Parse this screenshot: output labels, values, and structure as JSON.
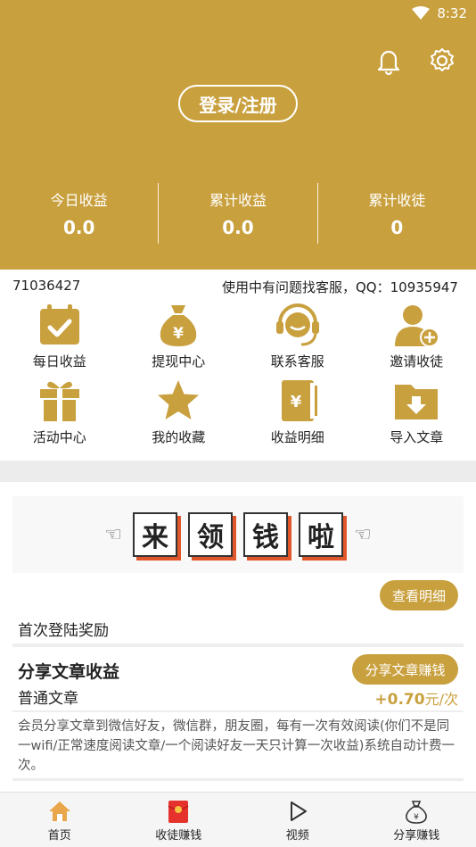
{
  "status_bar": {
    "time": "8:32"
  },
  "header": {
    "login_label": "登录/注册",
    "stats": [
      {
        "label": "今日收益",
        "value": "0.0"
      },
      {
        "label": "累计收益",
        "value": "0.0"
      },
      {
        "label": "累计收徒",
        "value": "0"
      }
    ]
  },
  "notice": {
    "left": "71036427",
    "right": "使用中有问题找客服，QQ：10935947"
  },
  "grid": [
    {
      "label": "每日收益",
      "icon": "calendar-check-icon"
    },
    {
      "label": "提现中心",
      "icon": "money-bag-icon"
    },
    {
      "label": "联系客服",
      "icon": "headset-icon"
    },
    {
      "label": "邀请收徒",
      "icon": "add-user-icon"
    },
    {
      "label": "活动中心",
      "icon": "gift-icon"
    },
    {
      "label": "我的收藏",
      "icon": "star-icon"
    },
    {
      "label": "收益明细",
      "icon": "ledger-icon"
    },
    {
      "label": "导入文章",
      "icon": "folder-download-icon"
    }
  ],
  "banner": {
    "chars": [
      "来",
      "领",
      "钱",
      "啦"
    ]
  },
  "rewards": {
    "detail_button": "查看明细",
    "first_login": "首次登陆奖励",
    "card": {
      "title": "分享文章收益",
      "button": "分享文章赚钱",
      "subtitle": "普通文章",
      "amount": "+0.70",
      "unit": "元/次",
      "description": "会员分享文章到微信好友，微信群，朋友圈，每有一次有效阅读(你们不是同一wifi/正常速度阅读文章/一个阅读好友一天只计算一次收益)系统自动计费一次。"
    }
  },
  "bottom_nav": [
    {
      "label": "首页",
      "icon": "home-icon"
    },
    {
      "label": "收徒赚钱",
      "icon": "red-envelope-icon"
    },
    {
      "label": "视频",
      "icon": "play-icon"
    },
    {
      "label": "分享赚钱",
      "icon": "money-bag-icon"
    }
  ],
  "colors": {
    "brand": "#C9A03E",
    "accent_orange": "#e2562b",
    "text": "#222222"
  }
}
